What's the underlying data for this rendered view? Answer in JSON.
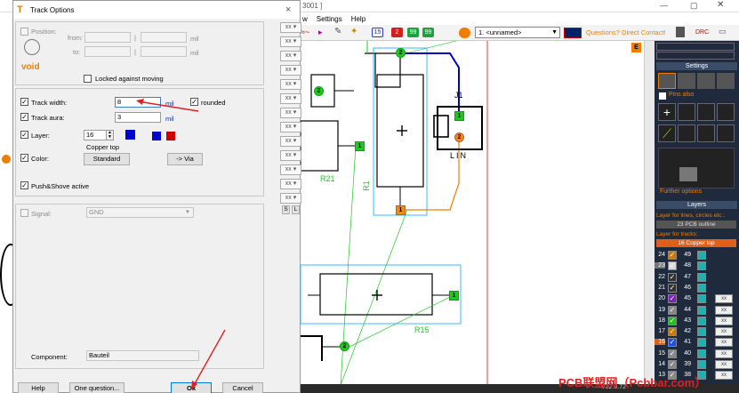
{
  "main_window": {
    "title_fragment": "3001 ]",
    "menu": [
      "w",
      "Settings",
      "Help"
    ],
    "toolbar": {
      "layer_buttons": [
        "15",
        "2",
        "99",
        "99"
      ],
      "macro_dropdown": "1. <unnamed>",
      "contact_text": "Questions? Direct Contact!",
      "drc_label": "DRC"
    },
    "canvas": {
      "labels": {
        "j1": "J1",
        "lin": "LIN",
        "r21": "R21",
        "r1": "R1",
        "r15": "R15"
      },
      "pad_numbers": {
        "one": "1",
        "two": "2"
      },
      "corner_badge": "E"
    },
    "right_panel": {
      "settings_header": "Settings",
      "pins_also": "Pins also",
      "further_options": "Further options",
      "layers_header": "Layers",
      "layer_for_lines": "Layer for lines, circles etc.:",
      "outline_layer": "23 PCB outline",
      "layer_for_tracks": "Layer for tracks:",
      "tracks_layer": "16 Copper top",
      "layer_numbers_left": [
        "24",
        "23",
        "22",
        "21",
        "20",
        "19",
        "18",
        "17",
        "16",
        "15",
        "14",
        "13"
      ],
      "layer_numbers_right": [
        "49",
        "48",
        "47",
        "46",
        "45",
        "44",
        "43",
        "42",
        "41",
        "40",
        "39",
        "38"
      ]
    },
    "status": "V32.0.72",
    "watermark": "PCB联盟网（Pcbbar.com）"
  },
  "dialog": {
    "title": "Track Options",
    "close": "×",
    "position": {
      "label": "Position:",
      "from_label": "from:",
      "to_label": "to:",
      "separator": "|",
      "unit": "mil",
      "void_text": "void",
      "locked_label": "Locked against moving"
    },
    "track_width": {
      "label": "Track width:",
      "value": "8",
      "unit": "mil",
      "rounded_label": "rounded"
    },
    "track_aura": {
      "label": "Track aura:",
      "value": "3",
      "unit": "mil"
    },
    "layer": {
      "label": "Layer:",
      "value": "16",
      "name": "Copper top"
    },
    "color": {
      "label": "Color:",
      "button": "Standard",
      "via_button": "-> Via"
    },
    "push_shove": {
      "label": "Push&Shove active"
    },
    "signal": {
      "label": "Signal:",
      "value": "GND"
    },
    "component": {
      "label": "Component:",
      "value": "Bauteil"
    },
    "side_buttons": {
      "s": "S",
      "l": "L"
    },
    "buttons": {
      "help": "Help",
      "one_question": "One question...",
      "ok": "Ok",
      "cancel": "Cancel"
    }
  },
  "colors": {
    "accent_orange": "#f07d00",
    "annotation_red": "#e02020",
    "copper_blue": "#0000cc",
    "copper_red": "#cc0000",
    "pad_green": "#1ec81e"
  }
}
